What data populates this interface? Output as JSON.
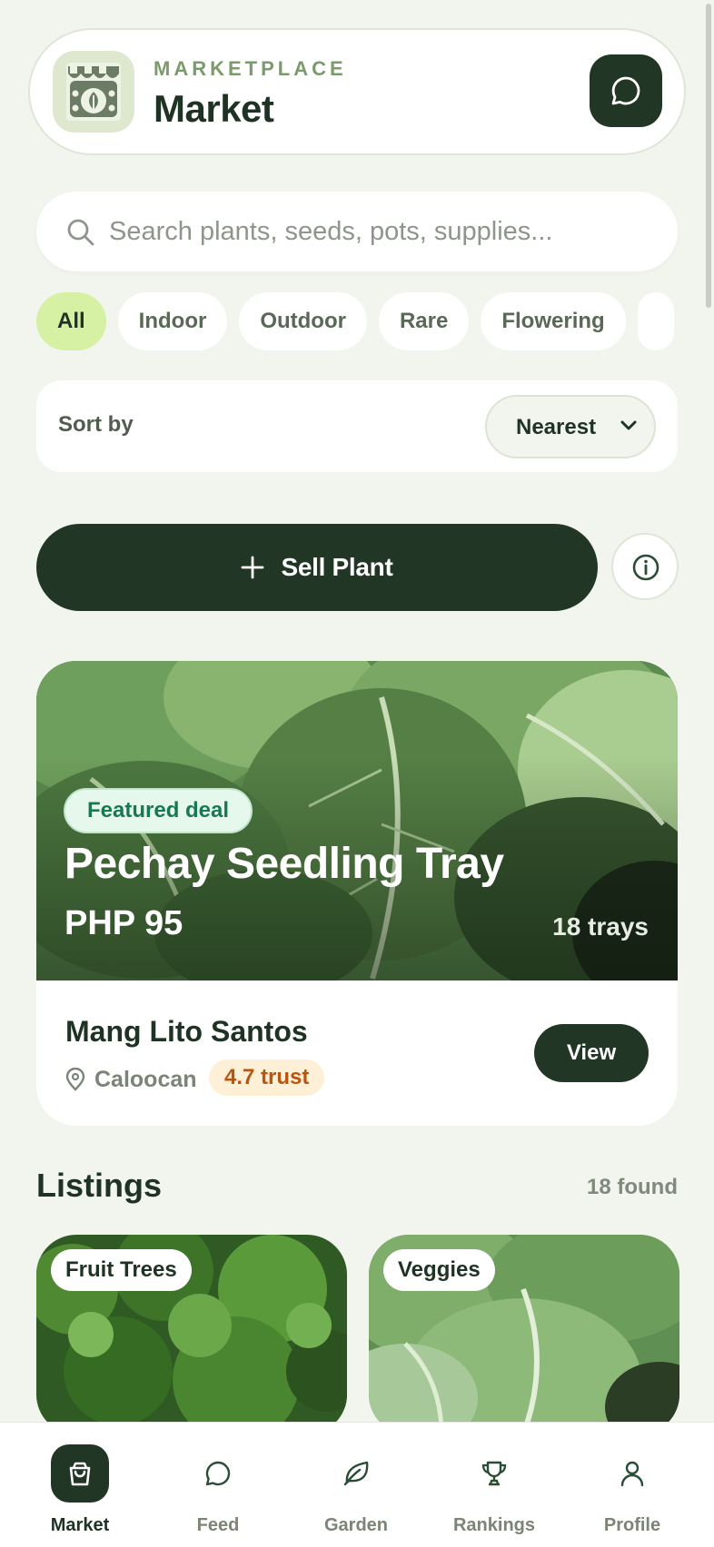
{
  "header": {
    "kicker": "MARKETPLACE",
    "title": "Market",
    "logo_icon": "market-stall-leaf-icon",
    "chat_icon": "chat-bubble-icon"
  },
  "search": {
    "placeholder": "Search plants, seeds, pots, supplies...",
    "value": ""
  },
  "filters": {
    "chips": [
      "All",
      "Indoor",
      "Outdoor",
      "Rare",
      "Flowering"
    ],
    "selected": "All"
  },
  "sort": {
    "label": "Sort by",
    "value": "Nearest"
  },
  "actions": {
    "sell_label": "Sell Plant",
    "info_icon": "info-circle-icon"
  },
  "featured": {
    "badge": "Featured deal",
    "title": "Pechay Seedling Tray",
    "price": "PHP 95",
    "quantity": "18 trays",
    "seller": "Mang Lito Santos",
    "location": "Caloocan",
    "trust": "4.7 trust",
    "view_label": "View"
  },
  "listings": {
    "title": "Listings",
    "count": "18 found",
    "items": [
      {
        "tag": "Fruit Trees"
      },
      {
        "tag": "Veggies"
      }
    ]
  },
  "nav": {
    "items": [
      {
        "label": "Market",
        "icon": "shopping-bag-icon",
        "active": true
      },
      {
        "label": "Feed",
        "icon": "chat-bubble-icon",
        "active": false
      },
      {
        "label": "Garden",
        "icon": "leaf-icon",
        "active": false
      },
      {
        "label": "Rankings",
        "icon": "trophy-icon",
        "active": false
      },
      {
        "label": "Profile",
        "icon": "user-icon",
        "active": false
      }
    ]
  },
  "colors": {
    "background": "#f2f5ee",
    "primary_dark": "#213625",
    "chip_active": "#d6f0a4",
    "accent_green": "#7c9b6c",
    "trust_text": "#b8560f"
  }
}
